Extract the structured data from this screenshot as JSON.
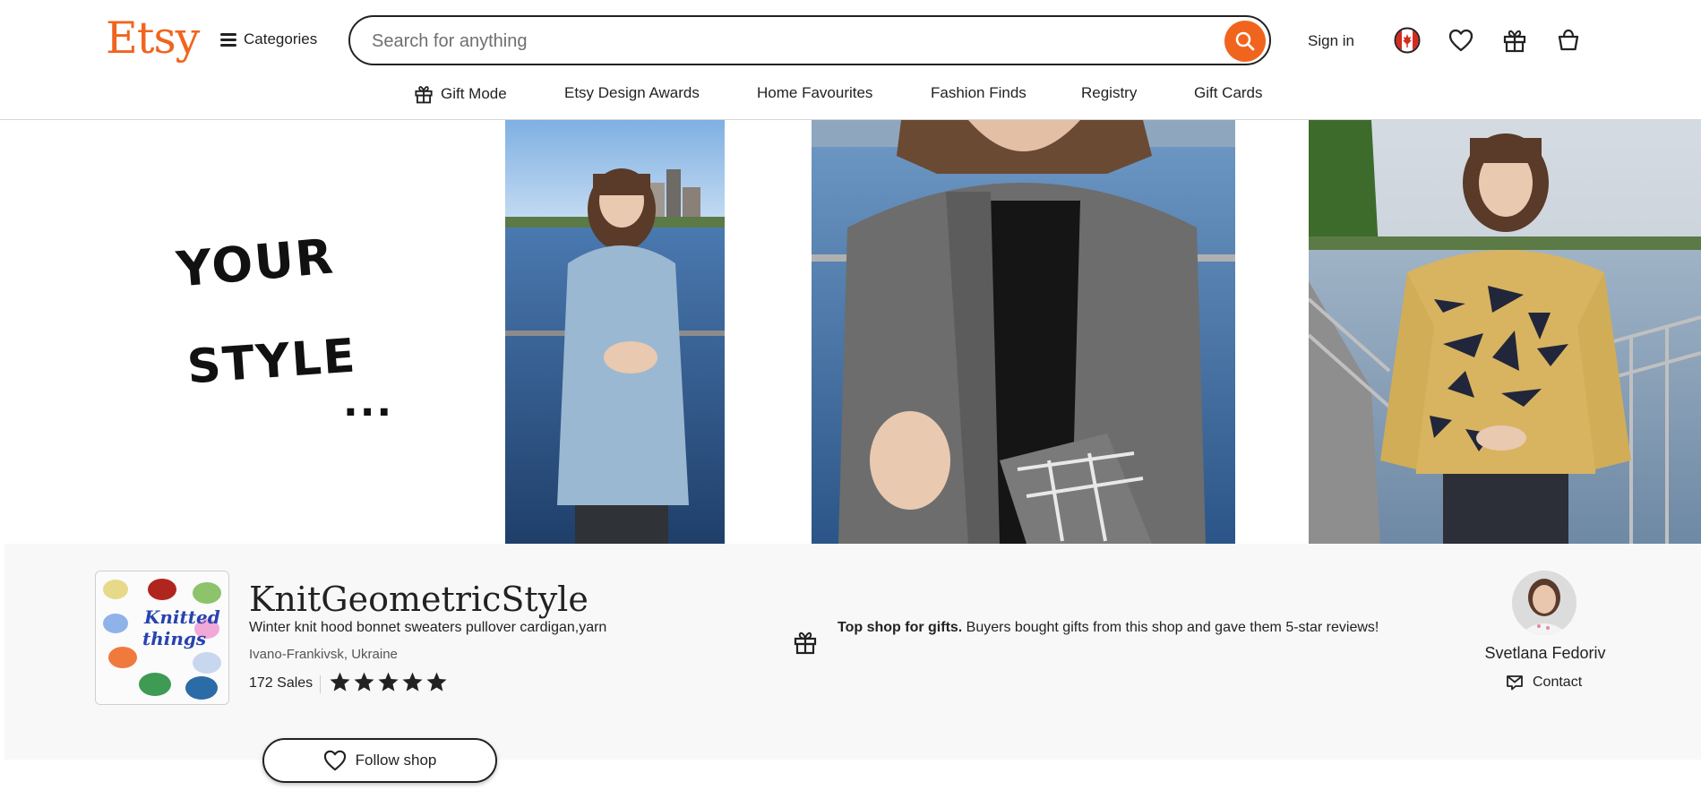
{
  "header": {
    "logo_text": "Etsy",
    "categories_label": "Categories",
    "search_placeholder": "Search for anything",
    "sign_in_label": "Sign in",
    "icons": [
      "hamburger-icon",
      "search-icon",
      "canada-flag-icon",
      "heart-icon",
      "gift-icon",
      "cart-icon"
    ],
    "accent_color": "#f1641e"
  },
  "nav": {
    "items": [
      {
        "label": "Gift Mode",
        "icon": "gift-icon"
      },
      {
        "label": "Etsy Design Awards"
      },
      {
        "label": "Home Favourites"
      },
      {
        "label": "Fashion Finds"
      },
      {
        "label": "Registry"
      },
      {
        "label": "Gift Cards"
      }
    ]
  },
  "banner": {
    "line1": "YOUR",
    "line2": "STYLE",
    "line3": "..."
  },
  "shop": {
    "name": "KnitGeometricStyle",
    "tagline": "Winter knit hood bonnet sweaters pullover cardigan,yarn",
    "location": "Ivano-Frankivsk, Ukraine",
    "sales": "172 Sales",
    "rating_stars": 5,
    "logo_text_line1": "Knitted",
    "logo_text_line2": "things",
    "gift_title": "Top shop for gifts.",
    "gift_text": " Buyers bought gifts from this shop and gave them 5-star reviews!",
    "owner_name": "Svetlana Fedoriv",
    "contact_label": "Contact",
    "follow_label": "Follow shop"
  }
}
